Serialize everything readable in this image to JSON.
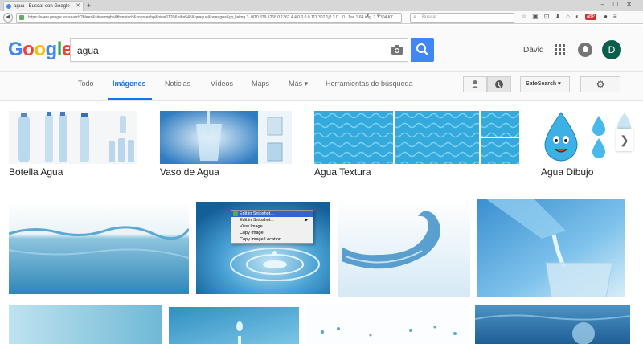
{
  "browser": {
    "tab_title": "agua - Buscar con Google",
    "url": "https://www.google.es/search?hl=es&site=imghp&tbm=isch&source=hp&biw=1120&bih=545&q=agua&oq=agua&gs_l=img.3..0l10.879.1268.0.1362.4.4.0.0.0.0.111.307.1j2.3.0....0...1ac.1.64.img..1.3.304.K7",
    "search_placeholder": "Buscar"
  },
  "google": {
    "logo_letters": [
      "G",
      "o",
      "o",
      "g",
      "l",
      "e"
    ],
    "query": "agua",
    "user_name": "David",
    "avatar_initial": "D",
    "colors": {
      "brand_blue": "#4285f4",
      "active_tab": "#1a73e8"
    }
  },
  "tabs": [
    {
      "label": "Todo"
    },
    {
      "label": "Imágenes",
      "active": true
    },
    {
      "label": "Noticias"
    },
    {
      "label": "Vídeos"
    },
    {
      "label": "Maps"
    },
    {
      "label": "Más ▾"
    },
    {
      "label": "Herramientas de búsqueda"
    }
  ],
  "filters": {
    "safesearch_label": "SafeSearch ▾"
  },
  "related": [
    {
      "label": "Botella Agua"
    },
    {
      "label": "Vaso de Agua"
    },
    {
      "label": "Agua Textura"
    },
    {
      "label": "Agua Dibujo"
    }
  ],
  "context_menu": {
    "items": [
      {
        "label": "Edit in Snipshot..."
      },
      {
        "label": "Edit in Snipshot..."
      },
      {
        "label": "View Image"
      },
      {
        "label": "Copy Image"
      },
      {
        "label": "Copy Image Location"
      }
    ]
  }
}
